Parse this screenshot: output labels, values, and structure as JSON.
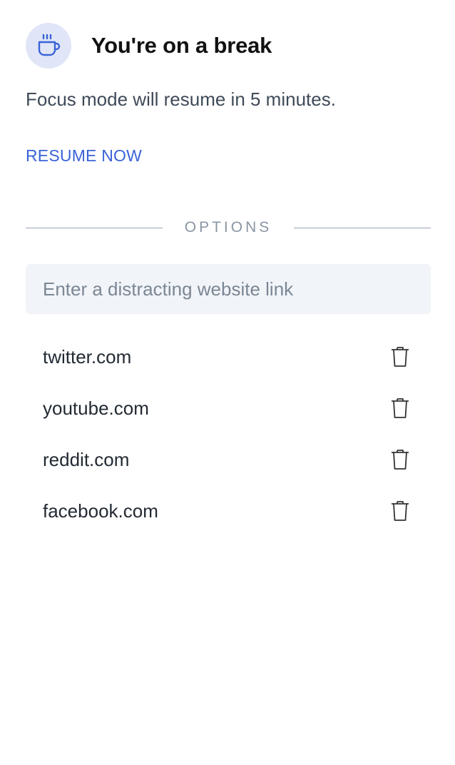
{
  "header": {
    "icon": "coffee-cup-icon",
    "title": "You're on a break"
  },
  "subtitle": "Focus mode will resume in 5 minutes.",
  "resume_label": "RESUME NOW",
  "options_label": "OPTIONS",
  "input": {
    "placeholder": "Enter a distracting website link",
    "value": ""
  },
  "sites": [
    {
      "name": "twitter.com",
      "icon": "trash-icon"
    },
    {
      "name": "youtube.com",
      "icon": "trash-icon"
    },
    {
      "name": "reddit.com",
      "icon": "trash-icon"
    },
    {
      "name": "facebook.com",
      "icon": "trash-icon"
    }
  ],
  "colors": {
    "accent": "#3b63d8",
    "icon_bg": "#e0e6f7",
    "input_bg": "#f1f4f8"
  }
}
